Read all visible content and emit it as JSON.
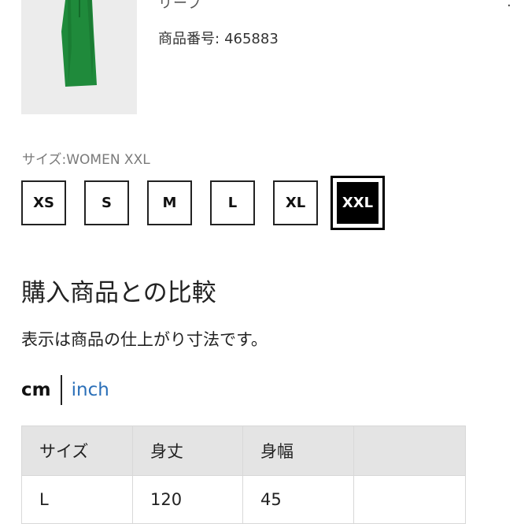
{
  "product": {
    "title_fragment": "リーブ",
    "number_label": "商品番号:",
    "number_value": "465883",
    "image_name": "green-dress-image"
  },
  "size_selector": {
    "label": "サイズ:WOMEN XXL",
    "options": [
      "XS",
      "S",
      "M",
      "L",
      "XL",
      "XXL"
    ],
    "selected": "XXL"
  },
  "comparison": {
    "title": "購入商品との比較",
    "note": "表示は商品の仕上がり寸法です。"
  },
  "units": {
    "cm_label": "cm",
    "inch_label": "inch",
    "active": "cm"
  },
  "size_table": {
    "headers": [
      "サイズ",
      "身丈",
      "身幅",
      ""
    ],
    "rows": [
      [
        "L",
        "120",
        "45",
        ""
      ]
    ]
  },
  "colors": {
    "dress": "#1f8a3b",
    "link": "#2a6fb8",
    "header_bg": "#e4e4e4"
  }
}
